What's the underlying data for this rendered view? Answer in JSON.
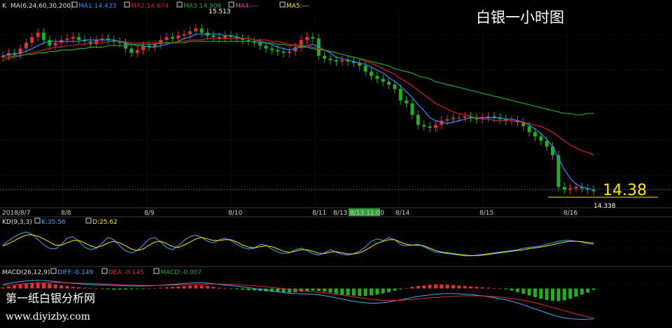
{
  "title": "白银一小时图",
  "main_legend": {
    "k": "K",
    "ma": "MA(6,24,60,30,200)",
    "ma1": "MA1:14.433",
    "ma2": "MA2:14.674",
    "ma3": "MA3:14.906",
    "ma4": "MA4:---",
    "ma5": "MA5:---"
  },
  "kd_legend": {
    "name": "KD(9,3,3)",
    "k": "K:35.56",
    "d": "D:25.62"
  },
  "macd_legend": {
    "name": "MACD(26,12,9)",
    "diff": "DIFF:-0.149",
    "dea": "DEA:-0.145",
    "macd": "MACD:-0.007"
  },
  "high_label": "15.513",
  "low_label": "14.338",
  "last_price": "14.38",
  "watermark": {
    "line1": "第一纸白银分析网",
    "line2": "www.diyizby.com"
  },
  "colors": {
    "background": "#000000",
    "up": "#e03030",
    "down": "#20b020",
    "ma1": "#2f8cff",
    "ma2": "#d21f1f",
    "ma3": "#27a52f",
    "ma4": "#e040c0",
    "ma5": "#ffe600",
    "kd_k": "#3fa9f5",
    "kd_d": "#ffe600",
    "highlight": "#2e9d3a"
  },
  "chart_data": [
    {
      "type": "candlestick",
      "x_ticks": [
        "2018/8/7",
        "8/8",
        "8/9",
        "8/10",
        "8/11",
        "8/13",
        "8/13 11:00",
        "8/14",
        "8/15",
        "8/16"
      ],
      "highlighted_tick": "8/13 11:00",
      "ylim": [
        14.28,
        15.6
      ],
      "annotations": {
        "high": 15.513,
        "low": 14.338,
        "last": 14.38
      },
      "close": [
        15.31,
        15.33,
        15.32,
        15.36,
        15.4,
        15.44,
        15.47,
        15.42,
        15.38,
        15.4,
        15.42,
        15.43,
        15.44,
        15.42,
        15.41,
        15.39,
        15.42,
        15.43,
        15.42,
        15.41,
        15.4,
        15.36,
        15.33,
        15.35,
        15.38,
        15.37,
        15.39,
        15.42,
        15.44,
        15.43,
        15.45,
        15.46,
        15.48,
        15.5,
        15.47,
        15.45,
        15.44,
        15.43,
        15.45,
        15.44,
        15.43,
        15.42,
        15.41,
        15.4,
        15.38,
        15.36,
        15.35,
        15.34,
        15.33,
        15.34,
        15.37,
        15.42,
        15.44,
        15.43,
        15.31,
        15.29,
        15.28,
        15.27,
        15.28,
        15.27,
        15.26,
        15.24,
        15.2,
        15.17,
        15.15,
        15.13,
        15.11,
        15.08,
        15.0,
        14.98,
        14.9,
        14.83,
        14.82,
        14.81,
        14.83,
        14.86,
        14.87,
        14.88,
        14.88,
        14.89,
        14.88,
        14.87,
        14.88,
        14.89,
        14.88,
        14.87,
        14.86,
        14.86,
        14.85,
        14.82,
        14.78,
        14.75,
        14.72,
        14.68,
        14.62,
        14.4,
        14.38,
        14.39,
        14.4,
        14.39,
        14.38,
        14.37
      ],
      "series": [
        {
          "name": "MA1",
          "values": [
            15.31,
            15.32,
            15.32,
            15.33,
            15.34,
            15.36,
            15.38,
            15.4,
            15.41,
            15.41,
            15.41,
            15.41,
            15.41,
            15.41,
            15.42,
            15.42,
            15.42,
            15.42,
            15.42,
            15.42,
            15.41,
            15.4,
            15.39,
            15.38,
            15.38,
            15.37,
            15.37,
            15.38,
            15.39,
            15.4,
            15.41,
            15.43,
            15.44,
            15.46,
            15.46,
            15.46,
            15.46,
            15.46,
            15.45,
            15.45,
            15.44,
            15.43,
            15.43,
            15.42,
            15.41,
            15.4,
            15.39,
            15.37,
            15.36,
            15.35,
            15.36,
            15.37,
            15.38,
            15.39,
            15.37,
            15.35,
            15.33,
            15.3,
            15.29,
            15.28,
            15.27,
            15.26,
            15.25,
            15.23,
            15.21,
            15.19,
            15.16,
            15.13,
            15.1,
            15.06,
            15.02,
            14.97,
            14.93,
            14.88,
            14.86,
            14.85,
            14.84,
            14.85,
            14.86,
            14.87,
            14.88,
            14.88,
            14.88,
            14.88,
            14.88,
            14.88,
            14.87,
            14.87,
            14.86,
            14.85,
            14.83,
            14.8,
            14.77,
            14.73,
            14.68,
            14.6,
            14.52,
            14.46,
            14.42,
            14.4,
            14.39,
            14.38
          ]
        },
        {
          "name": "MA2",
          "values": [
            15.28,
            15.29,
            15.3,
            15.31,
            15.32,
            15.33,
            15.34,
            15.35,
            15.36,
            15.37,
            15.37,
            15.38,
            15.38,
            15.39,
            15.39,
            15.4,
            15.4,
            15.4,
            15.41,
            15.41,
            15.41,
            15.41,
            15.4,
            15.4,
            15.4,
            15.4,
            15.4,
            15.4,
            15.4,
            15.4,
            15.41,
            15.41,
            15.42,
            15.42,
            15.42,
            15.43,
            15.43,
            15.43,
            15.43,
            15.43,
            15.43,
            15.43,
            15.43,
            15.42,
            15.42,
            15.42,
            15.41,
            15.41,
            15.4,
            15.39,
            15.39,
            15.38,
            15.38,
            15.37,
            15.36,
            15.35,
            15.34,
            15.33,
            15.32,
            15.31,
            15.3,
            15.29,
            15.27,
            15.26,
            15.24,
            15.22,
            15.2,
            15.18,
            15.15,
            15.13,
            15.1,
            15.07,
            15.04,
            15.01,
            14.98,
            14.96,
            14.94,
            14.92,
            14.91,
            14.9,
            14.89,
            14.88,
            14.87,
            14.87,
            14.86,
            14.86,
            14.86,
            14.86,
            14.85,
            14.85,
            14.84,
            14.83,
            14.82,
            14.8,
            14.78,
            14.75,
            14.72,
            14.69,
            14.67,
            14.65,
            14.64,
            14.62
          ]
        },
        {
          "name": "MA3",
          "values": [
            15.3,
            15.3,
            15.31,
            15.31,
            15.32,
            15.32,
            15.33,
            15.33,
            15.34,
            15.34,
            15.35,
            15.35,
            15.35,
            15.36,
            15.36,
            15.37,
            15.37,
            15.37,
            15.38,
            15.38,
            15.38,
            15.38,
            15.39,
            15.39,
            15.39,
            15.39,
            15.39,
            15.4,
            15.4,
            15.4,
            15.4,
            15.4,
            15.41,
            15.41,
            15.41,
            15.41,
            15.41,
            15.41,
            15.41,
            15.41,
            15.41,
            15.41,
            15.41,
            15.41,
            15.4,
            15.4,
            15.4,
            15.39,
            15.39,
            15.38,
            15.38,
            15.37,
            15.37,
            15.36,
            15.35,
            15.35,
            15.34,
            15.33,
            15.32,
            15.31,
            15.3,
            15.29,
            15.28,
            15.27,
            15.26,
            15.25,
            15.24,
            15.22,
            15.21,
            15.2,
            15.19,
            15.17,
            15.16,
            15.15,
            15.13,
            15.12,
            15.11,
            15.1,
            15.09,
            15.08,
            15.07,
            15.06,
            15.05,
            15.04,
            15.03,
            15.02,
            15.01,
            15.0,
            14.99,
            14.98,
            14.97,
            14.96,
            14.95,
            14.94,
            14.93,
            14.92,
            14.91,
            14.91,
            14.9,
            14.9,
            14.91,
            14.91
          ]
        }
      ]
    },
    {
      "type": "line",
      "name": "KD(9,3,3)",
      "ylim": [
        0,
        100
      ],
      "series": [
        {
          "name": "K",
          "values": [
            50,
            62,
            72,
            80,
            84,
            78,
            65,
            50,
            42,
            40,
            52,
            68,
            72,
            60,
            45,
            38,
            42,
            56,
            70,
            64,
            48,
            35,
            30,
            36,
            50,
            66,
            70,
            58,
            44,
            38,
            48,
            62,
            72,
            76,
            70,
            60,
            56,
            64,
            68,
            62,
            52,
            44,
            40,
            42,
            52,
            50,
            40,
            32,
            28,
            30,
            38,
            42,
            36,
            28,
            24,
            30,
            38,
            32,
            26,
            24,
            28,
            34,
            46,
            60,
            66,
            62,
            70,
            64,
            52,
            48,
            50,
            52,
            46,
            38,
            32,
            30,
            28,
            26,
            24,
            22,
            22,
            24,
            26,
            28,
            30,
            32,
            34,
            36,
            38,
            42,
            44,
            46,
            48,
            52,
            56,
            60,
            62,
            62,
            60,
            58,
            54,
            52
          ]
        },
        {
          "name": "D",
          "values": [
            48,
            54,
            62,
            70,
            76,
            77,
            73,
            66,
            58,
            50,
            50,
            56,
            62,
            62,
            56,
            48,
            44,
            48,
            56,
            60,
            56,
            48,
            40,
            36,
            40,
            50,
            58,
            60,
            54,
            46,
            44,
            50,
            58,
            66,
            70,
            66,
            62,
            62,
            64,
            64,
            58,
            50,
            45,
            43,
            46,
            48,
            46,
            40,
            34,
            31,
            34,
            38,
            38,
            34,
            29,
            28,
            32,
            33,
            30,
            27,
            27,
            30,
            37,
            46,
            55,
            60,
            64,
            64,
            58,
            52,
            50,
            50,
            48,
            42,
            36,
            32,
            30,
            28,
            26,
            24,
            23,
            23,
            24,
            26,
            28,
            30,
            32,
            34,
            36,
            38,
            41,
            43,
            45,
            48,
            51,
            55,
            58,
            60,
            60,
            59,
            57,
            55
          ]
        }
      ]
    },
    {
      "type": "bar",
      "name": "MACD(26,12,9)",
      "ylim": [
        -0.18,
        0.06
      ],
      "macd": [
        0.005,
        0.01,
        0.015,
        0.02,
        0.025,
        0.028,
        0.03,
        0.028,
        0.024,
        0.02,
        0.016,
        0.012,
        0.008,
        0.006,
        0.004,
        0.002,
        0.0,
        -0.002,
        -0.004,
        -0.006,
        -0.006,
        -0.005,
        -0.004,
        -0.003,
        -0.002,
        0.0,
        0.002,
        0.004,
        0.006,
        0.008,
        0.01,
        0.012,
        0.014,
        0.016,
        0.015,
        0.012,
        0.008,
        0.004,
        0.0,
        -0.002,
        -0.004,
        -0.006,
        -0.008,
        -0.01,
        -0.012,
        -0.014,
        -0.016,
        -0.018,
        -0.02,
        -0.02,
        -0.018,
        -0.015,
        -0.012,
        -0.01,
        -0.012,
        -0.015,
        -0.02,
        -0.025,
        -0.03,
        -0.033,
        -0.035,
        -0.036,
        -0.036,
        -0.034,
        -0.03,
        -0.024,
        -0.018,
        -0.01,
        -0.004,
        0.002,
        0.008,
        0.012,
        0.015,
        0.018,
        0.02,
        0.02,
        0.019,
        0.017,
        0.015,
        0.012,
        0.01,
        0.008,
        0.006,
        0.004,
        0.002,
        0.0,
        -0.004,
        -0.01,
        -0.018,
        -0.026,
        -0.034,
        -0.042,
        -0.05,
        -0.056,
        -0.06,
        -0.062,
        -0.058,
        -0.05,
        -0.04,
        -0.03,
        -0.02,
        -0.007
      ],
      "series": [
        {
          "name": "DIFF",
          "values": [
            0.02,
            0.025,
            0.03,
            0.034,
            0.037,
            0.039,
            0.04,
            0.039,
            0.037,
            0.034,
            0.031,
            0.028,
            0.025,
            0.023,
            0.021,
            0.019,
            0.018,
            0.017,
            0.016,
            0.015,
            0.014,
            0.013,
            0.012,
            0.012,
            0.012,
            0.013,
            0.014,
            0.016,
            0.018,
            0.02,
            0.022,
            0.024,
            0.026,
            0.028,
            0.028,
            0.026,
            0.023,
            0.02,
            0.017,
            0.014,
            0.011,
            0.008,
            0.004,
            0.0,
            -0.004,
            -0.008,
            -0.012,
            -0.016,
            -0.02,
            -0.023,
            -0.025,
            -0.026,
            -0.027,
            -0.028,
            -0.031,
            -0.035,
            -0.04,
            -0.046,
            -0.052,
            -0.058,
            -0.063,
            -0.067,
            -0.07,
            -0.072,
            -0.072,
            -0.07,
            -0.066,
            -0.061,
            -0.056,
            -0.05,
            -0.044,
            -0.039,
            -0.035,
            -0.031,
            -0.028,
            -0.026,
            -0.025,
            -0.025,
            -0.026,
            -0.028,
            -0.03,
            -0.033,
            -0.036,
            -0.04,
            -0.045,
            -0.05,
            -0.056,
            -0.063,
            -0.071,
            -0.08,
            -0.09,
            -0.1,
            -0.11,
            -0.12,
            -0.13,
            -0.138,
            -0.144,
            -0.148,
            -0.15,
            -0.151,
            -0.15,
            -0.149
          ]
        },
        {
          "name": "DEA",
          "values": [
            0.015,
            0.017,
            0.019,
            0.021,
            0.023,
            0.025,
            0.027,
            0.028,
            0.029,
            0.029,
            0.029,
            0.028,
            0.027,
            0.026,
            0.025,
            0.024,
            0.023,
            0.022,
            0.021,
            0.02,
            0.019,
            0.018,
            0.017,
            0.016,
            0.015,
            0.015,
            0.015,
            0.015,
            0.016,
            0.016,
            0.017,
            0.018,
            0.019,
            0.02,
            0.021,
            0.022,
            0.022,
            0.022,
            0.021,
            0.02,
            0.019,
            0.017,
            0.015,
            0.013,
            0.011,
            0.008,
            0.005,
            0.002,
            -0.001,
            -0.004,
            -0.007,
            -0.01,
            -0.013,
            -0.015,
            -0.018,
            -0.021,
            -0.024,
            -0.028,
            -0.032,
            -0.036,
            -0.041,
            -0.045,
            -0.049,
            -0.053,
            -0.056,
            -0.058,
            -0.059,
            -0.059,
            -0.058,
            -0.056,
            -0.054,
            -0.051,
            -0.049,
            -0.046,
            -0.044,
            -0.042,
            -0.04,
            -0.038,
            -0.037,
            -0.036,
            -0.036,
            -0.036,
            -0.037,
            -0.038,
            -0.04,
            -0.042,
            -0.045,
            -0.049,
            -0.053,
            -0.058,
            -0.064,
            -0.07,
            -0.077,
            -0.085,
            -0.093,
            -0.101,
            -0.109,
            -0.117,
            -0.125,
            -0.132,
            -0.139,
            -0.145
          ]
        }
      ]
    }
  ]
}
